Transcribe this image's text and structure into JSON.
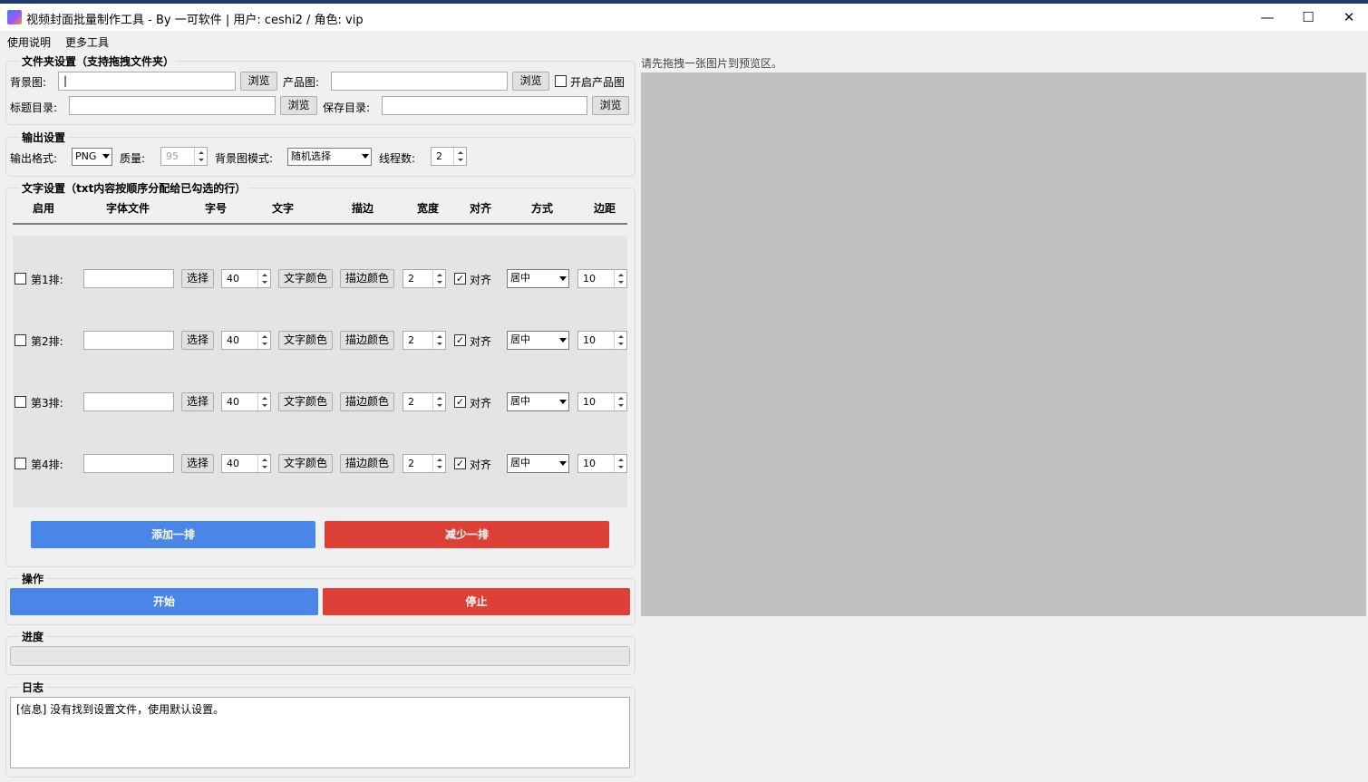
{
  "window": {
    "title": "视频封面批量制作工具 - By 一可软件 | 用户: ceshi2 / 角色: vip",
    "minimize": "—",
    "maximize": "☐",
    "close": "✕"
  },
  "menu": [
    "使用说明",
    "更多工具"
  ],
  "folder": {
    "title": "文件夹设置（支持拖拽文件夹）",
    "bg_label": "背景图:",
    "bg_value": "|",
    "product_label": "产品图:",
    "product_value": "",
    "browse": "浏览",
    "enable_product": "开启产品图",
    "title_dir_label": "标题目录:",
    "title_dir_value": "",
    "save_dir_label": "保存目录:",
    "save_dir_value": ""
  },
  "output": {
    "title": "输出设置",
    "format_label": "输出格式:",
    "format_value": "PNG",
    "quality_label": "质量:",
    "quality_value": "95",
    "bg_mode_label": "背景图模式:",
    "bg_mode_value": "随机选择",
    "threads_label": "线程数:",
    "threads_value": "2"
  },
  "text": {
    "title": "文字设置（txt内容按顺序分配给已勾选的行）",
    "headers": [
      "启用",
      "字体文件",
      "字号",
      "文字",
      "描边",
      "宽度",
      "对齐",
      "方式",
      "边距"
    ],
    "select_btn": "选择",
    "text_color_btn": "文字颜色",
    "stroke_color_btn": "描边颜色",
    "align_label": "对齐",
    "rows": [
      {
        "label": "第1排:",
        "size": "40",
        "width": "2",
        "align_checked": "✓",
        "mode": "居中",
        "margin": "10"
      },
      {
        "label": "第2排:",
        "size": "40",
        "width": "2",
        "align_checked": "✓",
        "mode": "居中",
        "margin": "10"
      },
      {
        "label": "第3排:",
        "size": "40",
        "width": "2",
        "align_checked": "✓",
        "mode": "居中",
        "margin": "10"
      },
      {
        "label": "第4排:",
        "size": "40",
        "width": "2",
        "align_checked": "✓",
        "mode": "居中",
        "margin": "10"
      }
    ],
    "add_row": "添加一排",
    "remove_row": "减少一排"
  },
  "operation": {
    "title": "操作",
    "start": "开始",
    "stop": "停止"
  },
  "progress": {
    "title": "进度",
    "value": 0
  },
  "log": {
    "title": "日志",
    "content": "[信息] 没有找到设置文件，使用默认设置。"
  },
  "preview": {
    "hint": "请先拖拽一张图片到预览区。"
  },
  "colors": {
    "blue": "#4a86e8",
    "red": "#dc4037",
    "preview_bg": "#c0c0c0"
  }
}
